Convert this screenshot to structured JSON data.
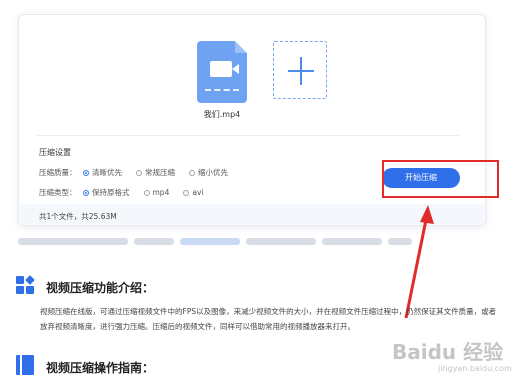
{
  "upload": {
    "file_name": "我们.mp4",
    "file_icon": "video-file-icon",
    "add_icon": "plus-icon"
  },
  "settings": {
    "title": "压缩设置",
    "quality_label": "压缩质量：",
    "quality_options": [
      "清晰优先",
      "常规压缩",
      "缩小优先"
    ],
    "quality_selected": "清晰优先",
    "type_label": "压缩类型：",
    "type_options": [
      "保持原格式",
      "mp4",
      "avi"
    ],
    "type_selected": "保持原格式",
    "start_button": "开始压缩"
  },
  "footer": {
    "summary": "共1个文件，共25.63M"
  },
  "section1": {
    "title": "视频压缩功能介绍：",
    "body": "视频压缩在线版，可通过压缩视频文件中的FPS以及图像，来减少视频文件的大小，并在视频文件压缩过程中，仍然保证其文件质量，或者放弃视频清晰度，进行强力压缩。压缩后的视频文件，同样可以借助常用的视频播放器来打开。",
    "icon": "grid-icon"
  },
  "section2": {
    "title": "视频压缩操作指南：",
    "icon": "book-icon"
  },
  "watermark": {
    "brand": "Baidu 经验",
    "url": "jingyan.baidu.com"
  },
  "colors": {
    "accent": "#2f6fea",
    "highlight": "#e22a2a"
  }
}
